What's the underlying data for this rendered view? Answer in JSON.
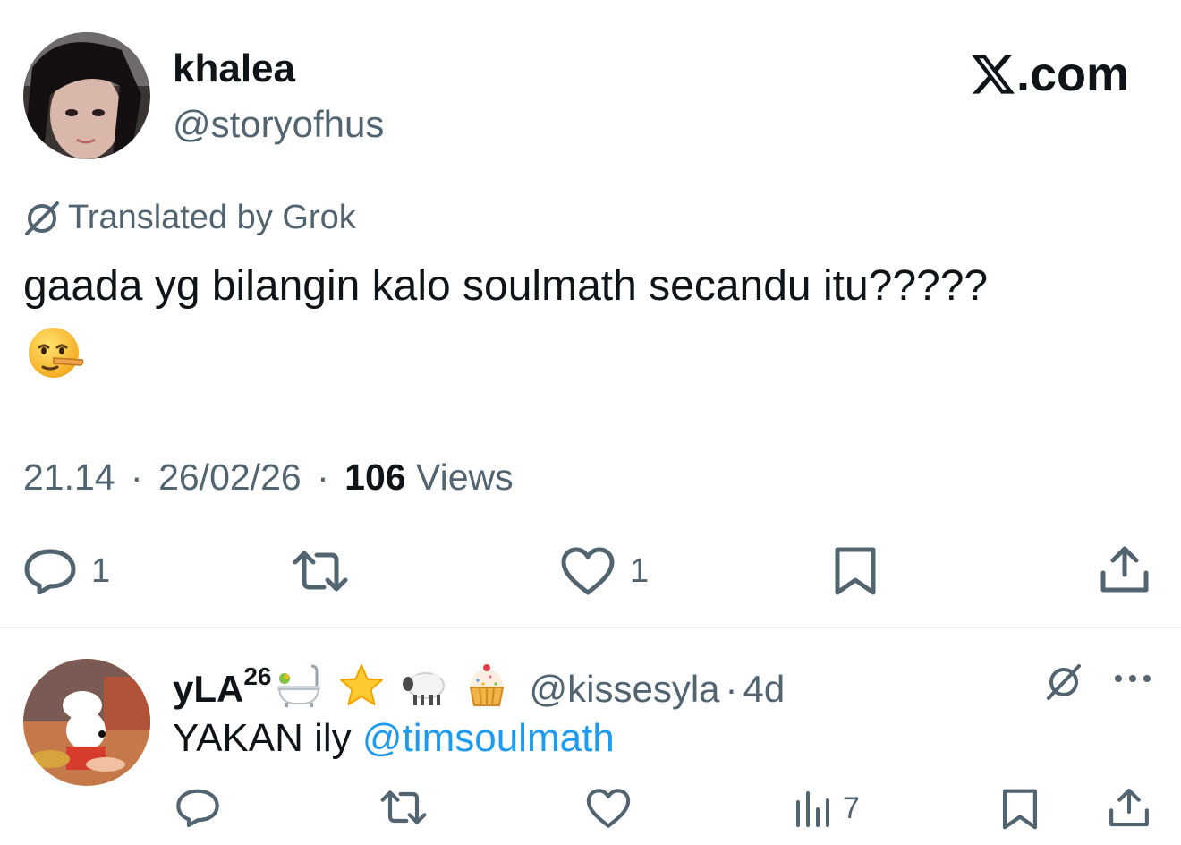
{
  "tweet": {
    "author_name": "khalea",
    "author_handle": "@storyofhus",
    "brand": ".com",
    "translated_label": "Translated by Grok",
    "text": "gaada yg bilangin kalo soulmath secandu itu?????",
    "emoji": "lying-face",
    "time": "21.14",
    "date": "26/02/26",
    "separator": "·",
    "views_count": "106",
    "views_label": "Views",
    "actions": {
      "reply_count": "1",
      "like_count": "1"
    }
  },
  "reply": {
    "author_name": "yLA",
    "author_name_sup": "26",
    "emojis": [
      "bathtub",
      "star",
      "sheep",
      "cupcake"
    ],
    "author_handle": "@kissesyla",
    "separator": "·",
    "age": "4d",
    "text": "YAKAN ily ",
    "mention": "@timsoulmath",
    "actions": {
      "views_count": "7"
    }
  },
  "colors": {
    "text_primary": "#0f1419",
    "text_secondary": "#536471",
    "link": "#1d9bf0",
    "divider": "#eff3f4"
  }
}
